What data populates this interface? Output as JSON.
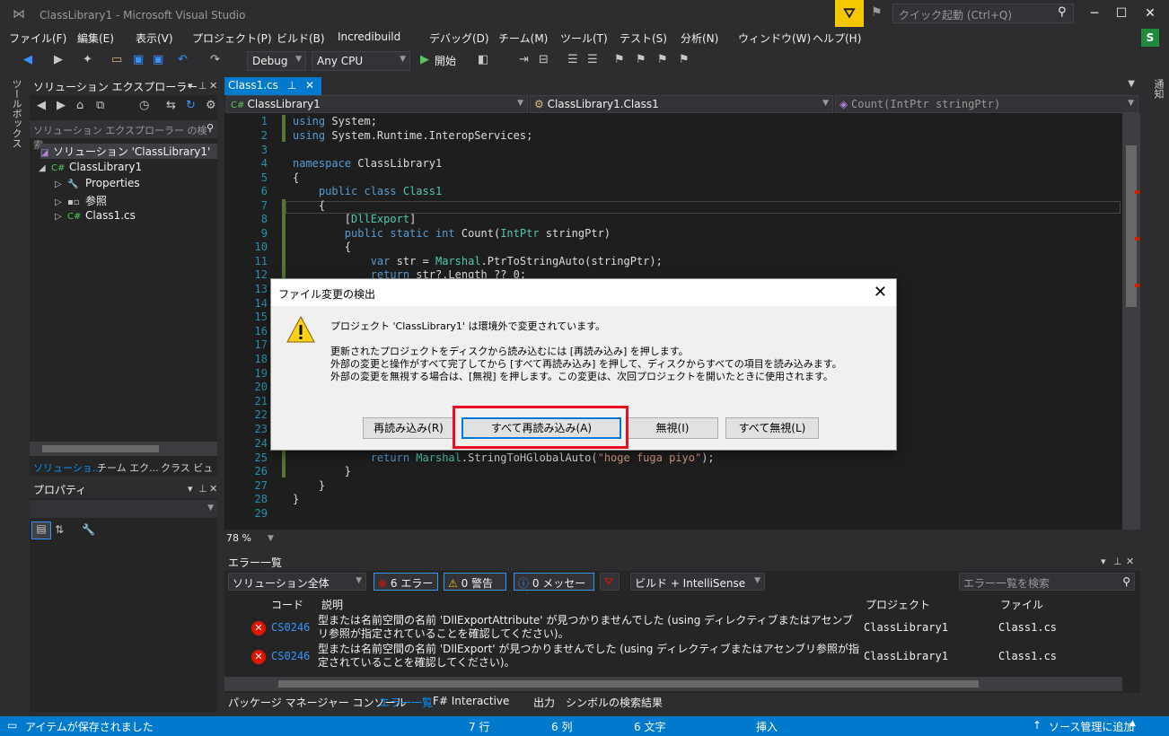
{
  "window": {
    "title": "ClassLibrary1 - Microsoft Visual Studio",
    "quick_launch_placeholder": "クイック起動 (Ctrl+Q)",
    "account_badge": "S"
  },
  "menu": [
    "ファイル(F)",
    "編集(E)",
    "表示(V)",
    "プロジェクト(P)",
    "ビルド(B)",
    "Incredibuild",
    "デバッグ(D)",
    "チーム(M)",
    "ツール(T)",
    "テスト(S)",
    "分析(N)",
    "ウィンドウ(W)",
    "ヘルプ(H)"
  ],
  "toolbar": {
    "config": "Debug",
    "platform": "Any CPU",
    "start": "開始"
  },
  "left_strip": {
    "label": "ツールボックス"
  },
  "right_strip": {
    "label": "通知"
  },
  "solution_explorer": {
    "title": "ソリューション エクスプローラー",
    "search_placeholder": "ソリューション エクスプローラー の検索",
    "items": [
      {
        "label": "ソリューション 'ClassLibrary1'"
      },
      {
        "label": "ClassLibrary1"
      },
      {
        "label": "Properties"
      },
      {
        "label": "参照"
      },
      {
        "label": "Class1.cs"
      }
    ],
    "tabs": [
      "ソリューショ...",
      "チーム エク...",
      "クラス ビュー"
    ]
  },
  "properties": {
    "title": "プロパティ"
  },
  "editor": {
    "tab": "Class1.cs",
    "nav_project": "ClassLibrary1",
    "nav_class": "ClassLibrary1.Class1",
    "nav_member": "Count(IntPtr stringPtr)",
    "zoom": "78 %",
    "line_numbers": [
      "1",
      "2",
      "3",
      "4",
      "5",
      "6",
      "7",
      "8",
      "9",
      "10",
      "11",
      "12",
      "13",
      "14",
      "15",
      "16",
      "17",
      "18",
      "19",
      "20",
      "21",
      "22",
      "23",
      "24",
      "25",
      "26",
      "27",
      "28",
      "29"
    ],
    "lines": {
      "l1": "using System;",
      "l2": "using System.Runtime.InteropServices;",
      "l4": "namespace ClassLibrary1",
      "l5": "{",
      "l6": "    public class Class1",
      "l7": "    {",
      "l8": "        [DllExport]",
      "l9": "        public static int Count(IntPtr stringPtr)",
      "l10": "        {",
      "l11": "            var str = Marshal.PtrToStringAuto(stringPtr);",
      "l12": "            return str?.Length ?? 0;",
      "l25": "            return Marshal.StringToHGlobalAuto(\"hoge fuga piyo\");",
      "l26": "        }",
      "l27": "    }",
      "l28": "}"
    }
  },
  "dialog": {
    "title": "ファイル変更の検出",
    "line1": "プロジェクト 'ClassLibrary1' は環境外で変更されています。",
    "line2": "更新されたプロジェクトをディスクから読み込むには [再読み込み] を押します。",
    "line3": "外部の変更と操作がすべて完了してから [すべて再読み込み] を押して、ディスクからすべての項目を読み込みます。",
    "line4": "外部の変更を無視する場合は、[無視] を押します。この変更は、次回プロジェクトを開いたときに使用されます。",
    "buttons": {
      "reload": "再読み込み(R)",
      "reload_all": "すべて再読み込み(A)",
      "ignore": "無視(I)",
      "ignore_all": "すべて無視(L)"
    }
  },
  "error_list": {
    "title": "エラー一覧",
    "scope": "ソリューション全体",
    "errors_btn": "6 エラー",
    "warnings_btn": "0 警告",
    "messages_btn": "0 メッセージ",
    "source": "ビルド + IntelliSense",
    "search_placeholder": "エラー一覧を検索",
    "columns": {
      "code": "コード",
      "desc": "説明",
      "project": "プロジェクト",
      "file": "ファイル"
    },
    "rows": [
      {
        "code": "CS0246",
        "desc": "型または名前空間の名前 'DllExportAttribute' が見つかりませんでした (using ディレクティブまたはアセンブリ参照が指定されていることを確認してください)。",
        "project": "ClassLibrary1",
        "file": "Class1.cs"
      },
      {
        "code": "CS0246",
        "desc": "型または名前空間の名前 'DllExport' が見つかりませんでした (using ディレクティブまたはアセンブリ参照が指定されていることを確認してください)。",
        "project": "ClassLibrary1",
        "file": "Class1.cs"
      }
    ]
  },
  "bottom_tabs": [
    "パッケージ マネージャー コンソール",
    "エラー一覧",
    "F# Interactive",
    "出力",
    "シンボルの検索結果"
  ],
  "status": {
    "message": "アイテムが保存されました",
    "line": "7 行",
    "col": "6 列",
    "ch": "6 文字",
    "mode": "挿入",
    "scm": "ソース管理に追加"
  }
}
